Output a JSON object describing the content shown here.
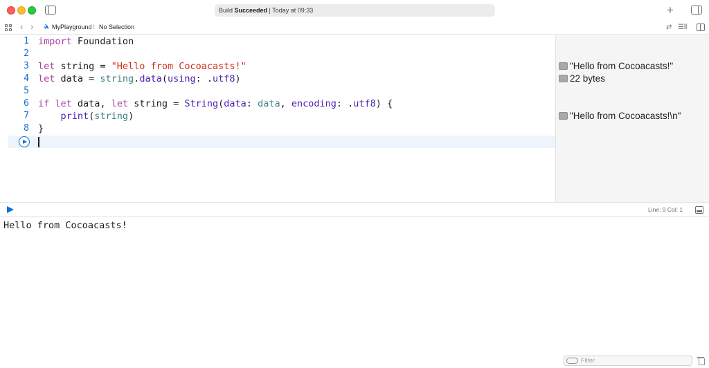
{
  "window": {
    "status_prefix": "Build ",
    "status_bold": "Succeeded",
    "status_suffix": " | Today at 09:33",
    "add_label": "+"
  },
  "jumpbar": {
    "project": "MyPlayground",
    "separator": "⟩",
    "selection": "No Selection",
    "back": "‹",
    "forward": "›",
    "related_items": "⇄",
    "adjust_editor": "☰⫴"
  },
  "editor": {
    "lines": [
      {
        "num": "1",
        "tokens": [
          {
            "t": "import",
            "c": "kw"
          },
          {
            "t": " Foundation",
            "c": ""
          }
        ]
      },
      {
        "num": "2",
        "tokens": []
      },
      {
        "num": "3",
        "tokens": [
          {
            "t": "let",
            "c": "kw"
          },
          {
            "t": " string = ",
            "c": ""
          },
          {
            "t": "\"Hello from Cocoacasts!\"",
            "c": "str"
          }
        ]
      },
      {
        "num": "4",
        "tokens": [
          {
            "t": "let",
            "c": "kw"
          },
          {
            "t": " data = ",
            "c": ""
          },
          {
            "t": "string",
            "c": "pm"
          },
          {
            "t": ".",
            "c": ""
          },
          {
            "t": "data",
            "c": "fn"
          },
          {
            "t": "(",
            "c": ""
          },
          {
            "t": "using",
            "c": "fn"
          },
          {
            "t": ": .",
            "c": ""
          },
          {
            "t": "utf8",
            "c": "fn"
          },
          {
            "t": ")",
            "c": ""
          }
        ]
      },
      {
        "num": "5",
        "tokens": []
      },
      {
        "num": "6",
        "tokens": [
          {
            "t": "if",
            "c": "kw"
          },
          {
            "t": " ",
            "c": ""
          },
          {
            "t": "let",
            "c": "kw"
          },
          {
            "t": " data, ",
            "c": ""
          },
          {
            "t": "let",
            "c": "kw"
          },
          {
            "t": " string = ",
            "c": ""
          },
          {
            "t": "String",
            "c": "fn"
          },
          {
            "t": "(",
            "c": ""
          },
          {
            "t": "data",
            "c": "fn"
          },
          {
            "t": ": ",
            "c": ""
          },
          {
            "t": "data",
            "c": "pm"
          },
          {
            "t": ", ",
            "c": ""
          },
          {
            "t": "encoding",
            "c": "fn"
          },
          {
            "t": ": .",
            "c": ""
          },
          {
            "t": "utf8",
            "c": "fn"
          },
          {
            "t": ") {",
            "c": ""
          }
        ]
      },
      {
        "num": "7",
        "tokens": [
          {
            "t": "    ",
            "c": ""
          },
          {
            "t": "print",
            "c": "fn"
          },
          {
            "t": "(",
            "c": ""
          },
          {
            "t": "string",
            "c": "pm"
          },
          {
            "t": ")",
            "c": ""
          }
        ]
      },
      {
        "num": "8",
        "tokens": [
          {
            "t": "}",
            "c": ""
          }
        ]
      }
    ]
  },
  "results": {
    "line3": "\"Hello from Cocoacasts!\"",
    "line4": "22 bytes",
    "line7": "\"Hello from Cocoacasts!\\n\""
  },
  "debug": {
    "position": "Line: 9  Col: 1"
  },
  "console": {
    "output": "Hello from Cocoacasts!",
    "filter_placeholder": "Filter"
  },
  "colors": {
    "line_number": "#0e6fd8",
    "keyword": "#ad3da4",
    "string": "#d12f1b",
    "identifier": "#4b21b0",
    "local": "#3e8087"
  }
}
